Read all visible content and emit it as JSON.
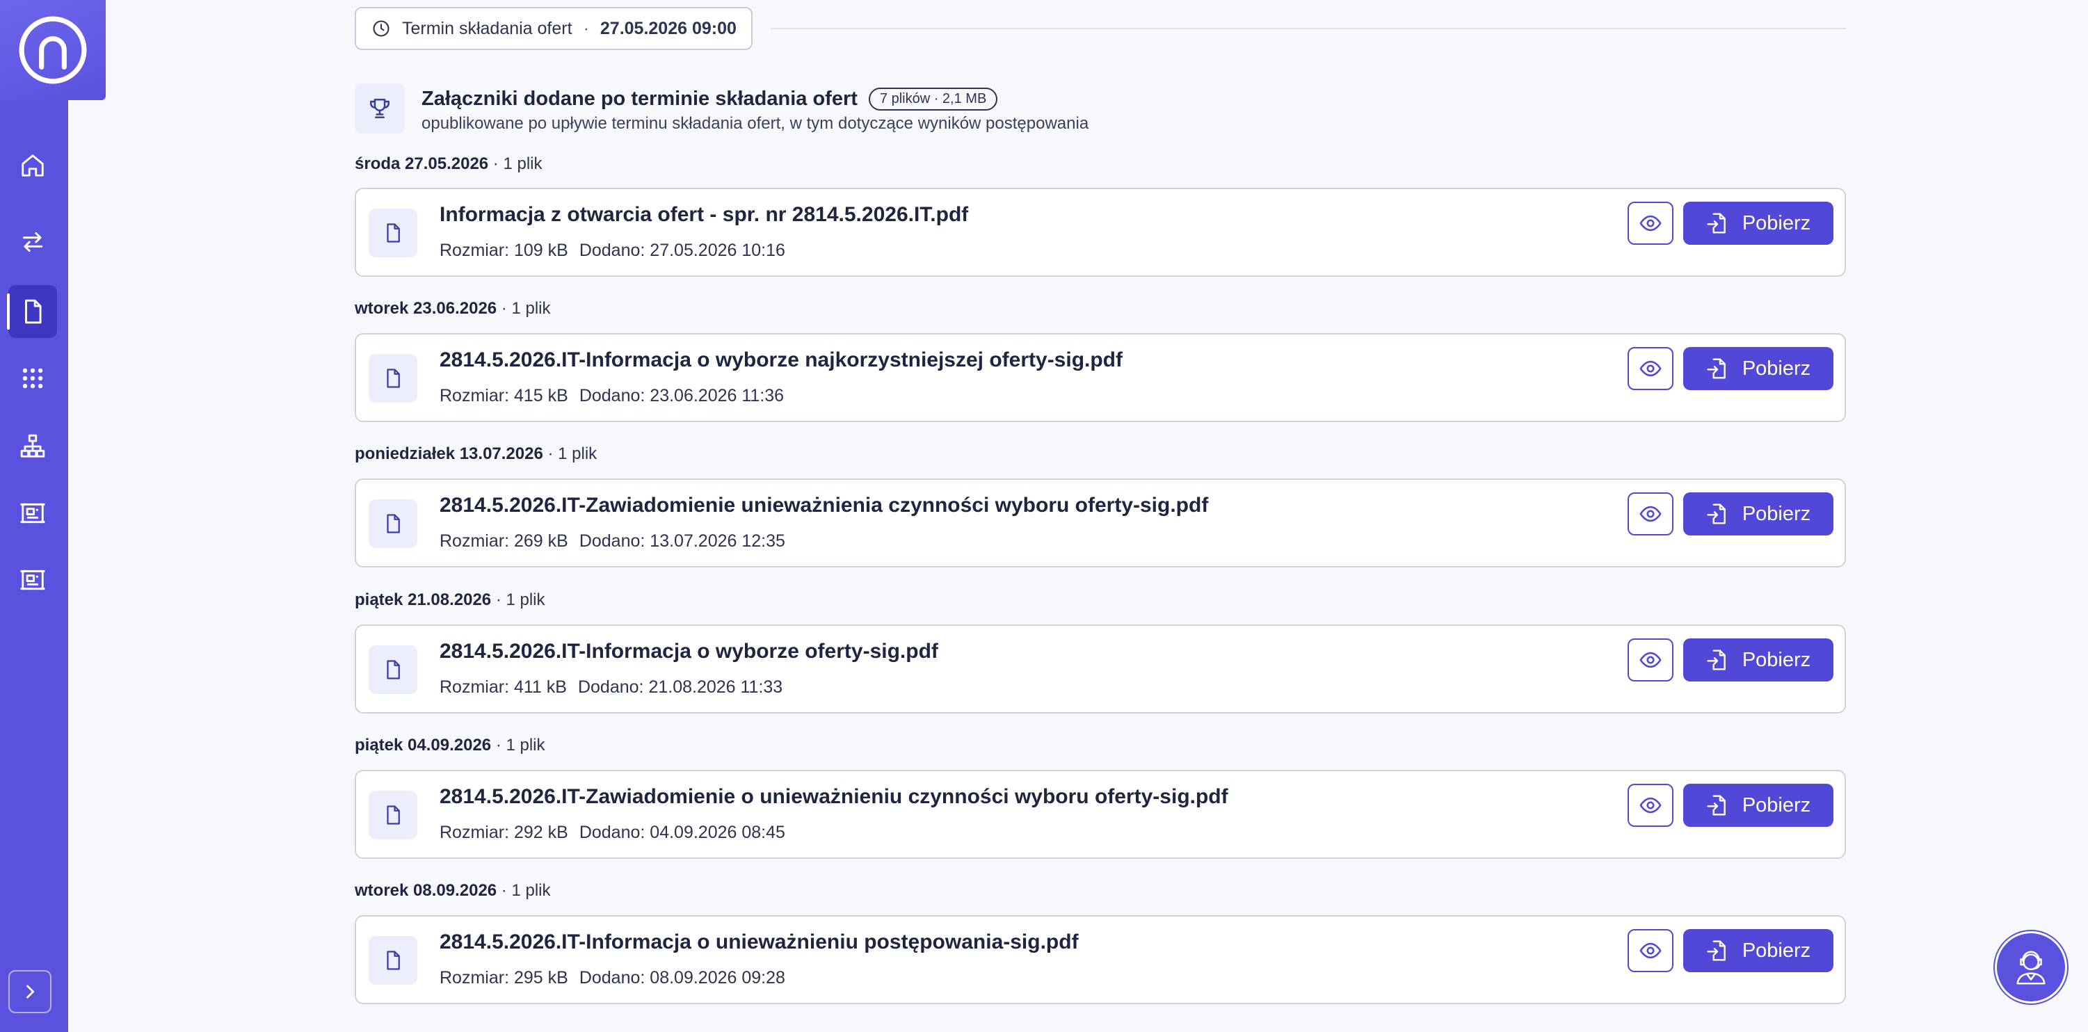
{
  "sidebar": {
    "items": [
      {
        "icon": "home-icon"
      },
      {
        "icon": "transfer-arrows-icon"
      },
      {
        "icon": "document-icon",
        "active": true
      },
      {
        "icon": "grid-icon"
      },
      {
        "icon": "sitemap-icon"
      },
      {
        "icon": "tender-icon"
      },
      {
        "icon": "tender-icon"
      }
    ],
    "expand_icon": "chevron-right-icon"
  },
  "deadline": {
    "label": "Termin składania ofert",
    "separator": "·",
    "value": "27.05.2026 09:00"
  },
  "section": {
    "title": "Załączniki dodane po terminie składania ofert",
    "badge": "7 plików · 2,1 MB",
    "subtitle": "opublikowane po upływie terminu składania ofert, w tym dotyczące wyników postępowania"
  },
  "labels": {
    "size_prefix": "Rozmiar:",
    "added_prefix": "Dodano:",
    "download": "Pobierz"
  },
  "groups": [
    {
      "date": "środa 27.05.2026",
      "count": " · 1 plik",
      "file": {
        "name": "Informacja z otwarcia ofert - spr. nr 2814.5.2026.IT.pdf",
        "size": "109 kB",
        "added": "27.05.2026 10:16"
      }
    },
    {
      "date": "wtorek 23.06.2026",
      "count": " · 1 plik",
      "file": {
        "name": "2814.5.2026.IT-Informacja o wyborze najkorzystniejszej oferty-sig.pdf",
        "size": "415 kB",
        "added": "23.06.2026 11:36"
      }
    },
    {
      "date": "poniedziałek 13.07.2026",
      "count": " · 1 plik",
      "file": {
        "name": "2814.5.2026.IT-Zawiadomienie unieważnienia czynności wyboru oferty-sig.pdf",
        "size": "269 kB",
        "added": "13.07.2026 12:35"
      }
    },
    {
      "date": "piątek 21.08.2026",
      "count": " · 1 plik",
      "file": {
        "name": "2814.5.2026.IT-Informacja o wyborze oferty-sig.pdf",
        "size": "411 kB",
        "added": "21.08.2026 11:33"
      }
    },
    {
      "date": "piątek 04.09.2026",
      "count": " · 1 plik",
      "file": {
        "name": "2814.5.2026.IT-Zawiadomienie o unieważnieniu czynności wyboru oferty-sig.pdf",
        "size": "292 kB",
        "added": "04.09.2026 08:45"
      }
    },
    {
      "date": "wtorek 08.09.2026",
      "count": " · 1 plik",
      "file": {
        "name": "2814.5.2026.IT-Informacja o unieważnieniu postępowania-sig.pdf",
        "size": "295 kB",
        "added": "08.09.2026 09:28"
      }
    }
  ],
  "colors": {
    "brand": "#5a52df",
    "button": "#5148d8",
    "text": "#1f2440"
  }
}
